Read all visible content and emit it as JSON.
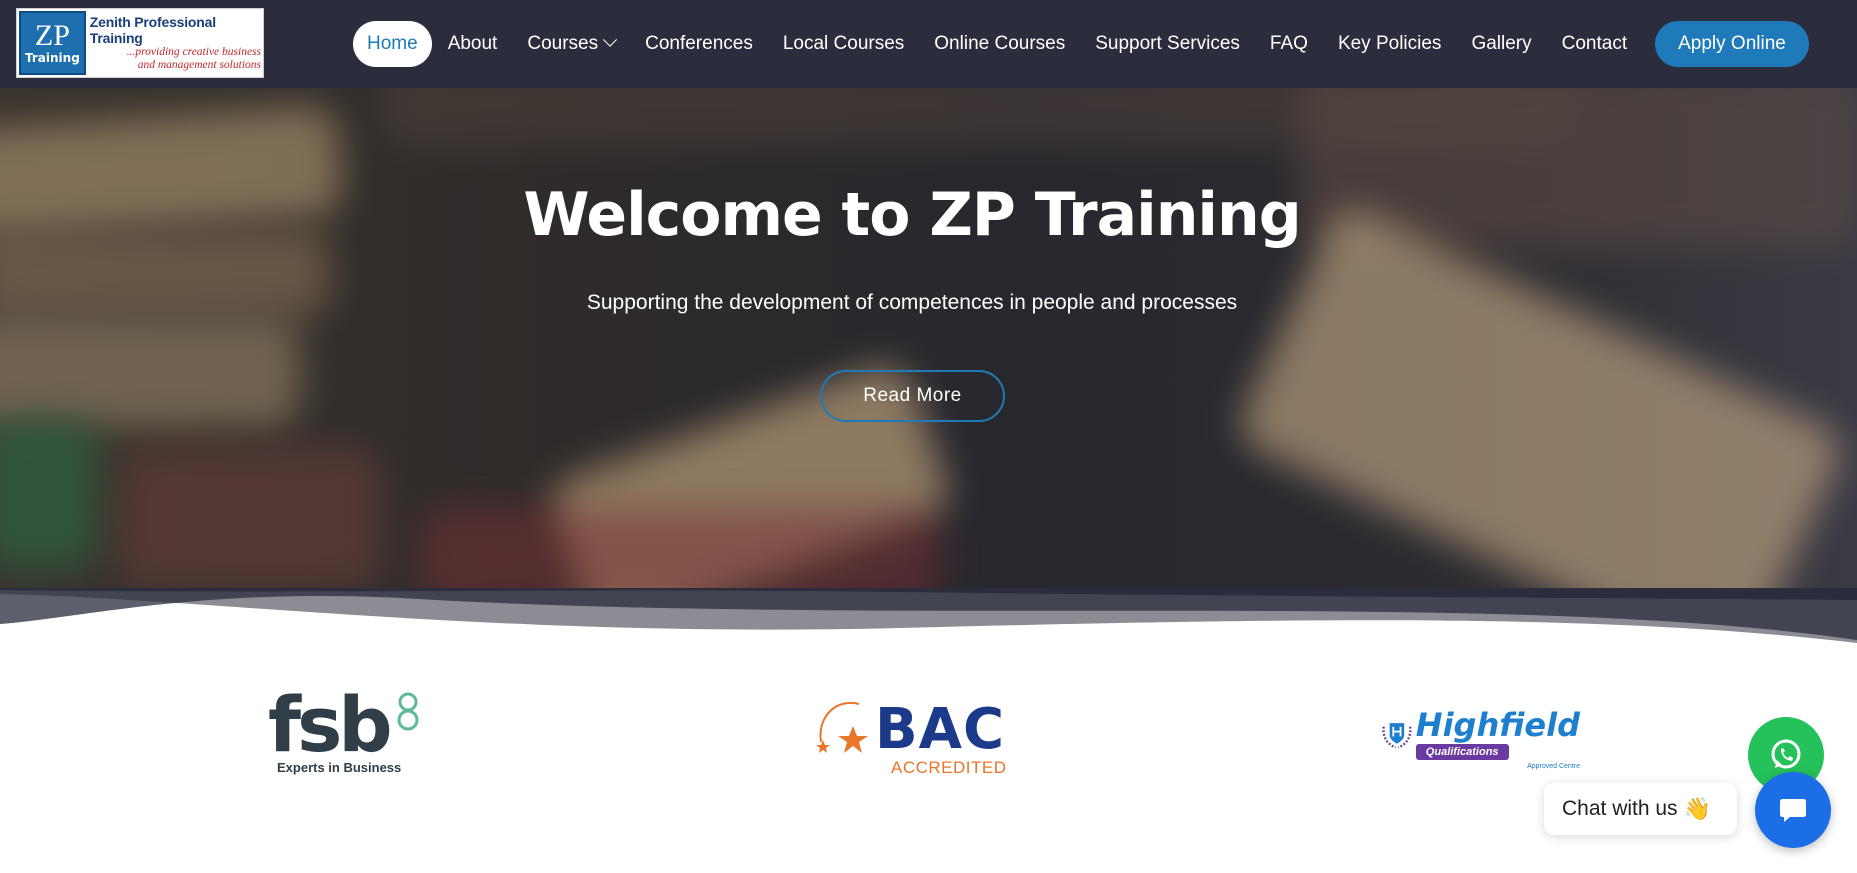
{
  "logo": {
    "big": "ZP",
    "small": "Training",
    "name": "Zenith Professional Training",
    "tagline_1": "...providing creative business",
    "tagline_2": "and management solutions"
  },
  "nav": {
    "items": [
      {
        "label": "Home",
        "active": true
      },
      {
        "label": "About"
      },
      {
        "label": "Courses",
        "dropdown": true
      },
      {
        "label": "Conferences"
      },
      {
        "label": "Local Courses"
      },
      {
        "label": "Online Courses"
      },
      {
        "label": "Support Services"
      },
      {
        "label": "FAQ"
      },
      {
        "label": "Key Policies"
      },
      {
        "label": "Gallery"
      },
      {
        "label": "Contact"
      }
    ],
    "apply_label": "Apply Online"
  },
  "hero": {
    "title": "Welcome to ZP Training",
    "subtitle": "Supporting the development of competences in people and processes",
    "button_label": "Read More"
  },
  "partners": {
    "fsb": {
      "word": "fsb",
      "tagline": "Experts in Business"
    },
    "bac": {
      "word": "BAC",
      "tagline": "ACCREDITED"
    },
    "highfield": {
      "word": "Highfield",
      "badge": "Qualifications",
      "tagline": "Approved Centre"
    }
  },
  "chat": {
    "bubble_text": "Chat with us",
    "bubble_emoji": "👋"
  },
  "colors": {
    "nav_bg": "#2c2d3c",
    "accent": "#1e7ab8",
    "whatsapp": "#25c15a",
    "chat": "#1c6ee6"
  },
  "icons": [
    "chevron-down-icon",
    "whatsapp-icon",
    "chat-icon",
    "star-icon"
  ]
}
